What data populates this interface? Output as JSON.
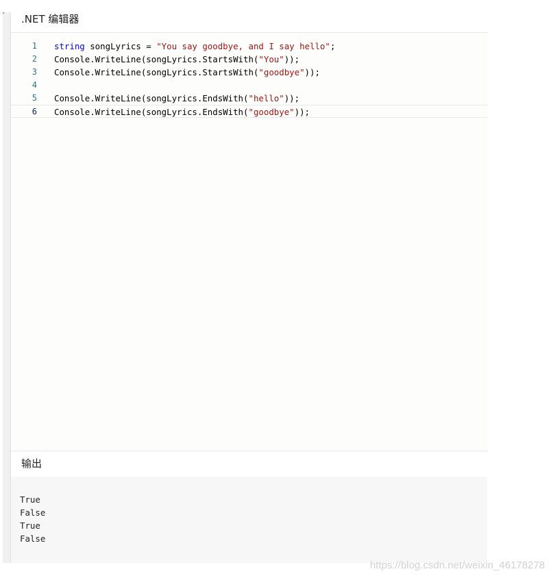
{
  "editor": {
    "title": ".NET 编辑器",
    "lines": [
      {
        "number": "1",
        "tokens": [
          {
            "kind": "kw",
            "text": "string"
          },
          {
            "kind": "plain",
            "text": " songLyrics = "
          },
          {
            "kind": "str",
            "text": "\"You say goodbye, and I say hello\""
          },
          {
            "kind": "plain",
            "text": ";"
          }
        ]
      },
      {
        "number": "2",
        "tokens": [
          {
            "kind": "plain",
            "text": "Console.WriteLine(songLyrics.StartsWith("
          },
          {
            "kind": "str",
            "text": "\"You\""
          },
          {
            "kind": "plain",
            "text": "));"
          }
        ]
      },
      {
        "number": "3",
        "tokens": [
          {
            "kind": "plain",
            "text": "Console.WriteLine(songLyrics.StartsWith("
          },
          {
            "kind": "str",
            "text": "\"goodbye\""
          },
          {
            "kind": "plain",
            "text": "));"
          }
        ]
      },
      {
        "number": "4",
        "tokens": []
      },
      {
        "number": "5",
        "tokens": [
          {
            "kind": "plain",
            "text": "Console.WriteLine(songLyrics.EndsWith("
          },
          {
            "kind": "str",
            "text": "\"hello\""
          },
          {
            "kind": "plain",
            "text": "));"
          }
        ]
      },
      {
        "number": "6",
        "current": true,
        "tokens": [
          {
            "kind": "plain",
            "text": "Console.WriteLine(songLyrics.EndsWith("
          },
          {
            "kind": "str",
            "text": "\"goodbye\""
          },
          {
            "kind": "plain",
            "text": "));"
          }
        ]
      }
    ]
  },
  "output": {
    "title": "输出",
    "lines": [
      "True",
      "False",
      "True",
      "False"
    ]
  },
  "watermark": "https://blog.csdn.net/weixin_46178278",
  "colors": {
    "keyword": "#0000ff",
    "string": "#a31515",
    "line_number": "#237893",
    "line_number_active": "#0b216f",
    "output_background": "#f7f7f7"
  }
}
